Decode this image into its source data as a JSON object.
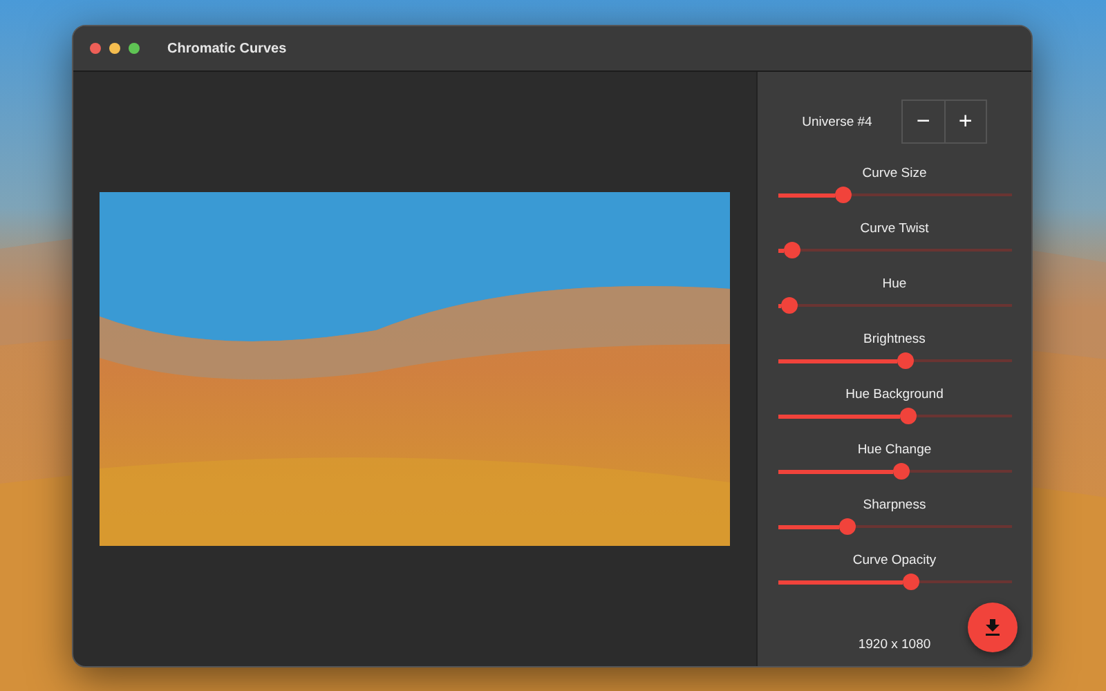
{
  "window": {
    "title": "Chromatic Curves"
  },
  "controls": {
    "universe": "Universe #4",
    "decrement": "−",
    "increment": "+"
  },
  "sliders": [
    {
      "label": "Curve Size",
      "level": 0.28
    },
    {
      "label": "Curve Twist",
      "level": 0.06
    },
    {
      "label": "Hue",
      "level": 0.05
    },
    {
      "label": "Brightness",
      "level": 0.55
    },
    {
      "label": "Hue Background",
      "level": 0.56
    },
    {
      "label": "Hue Change",
      "level": 0.53
    },
    {
      "label": "Sharpness",
      "level": 0.3
    },
    {
      "label": "Curve Opacity",
      "level": 0.57
    }
  ],
  "resolution": "1920 x 1080"
}
